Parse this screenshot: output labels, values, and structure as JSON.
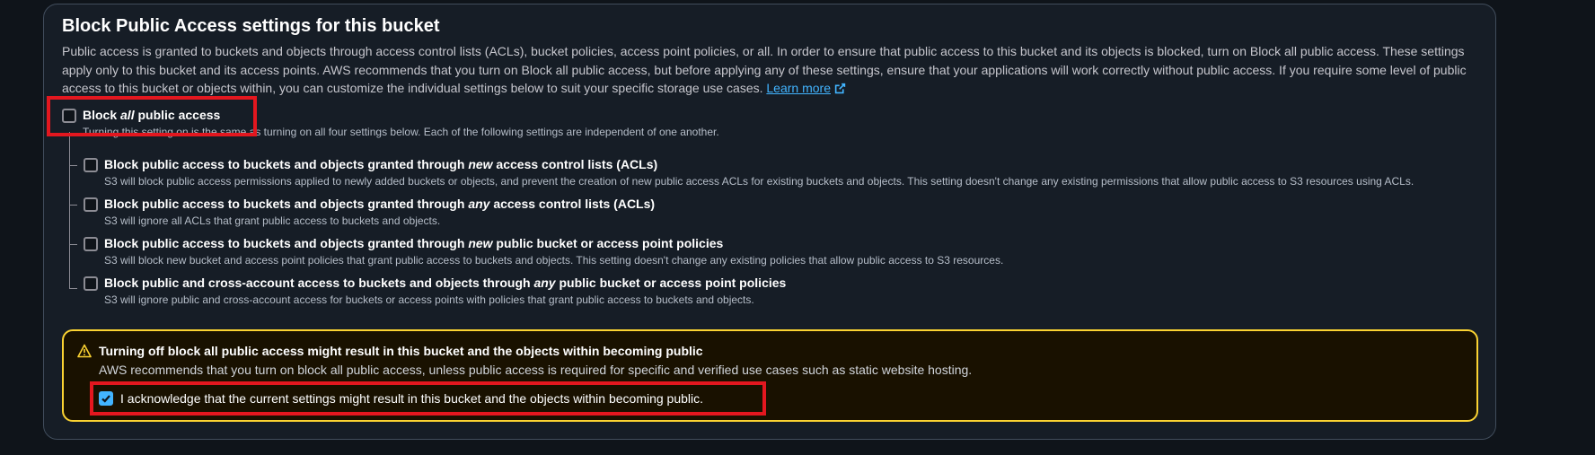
{
  "section": {
    "title": "Block Public Access settings for this bucket",
    "description": "Public access is granted to buckets and objects through access control lists (ACLs), bucket policies, access point policies, or all. In order to ensure that public access to this bucket and its objects is blocked, turn on Block all public access. These settings apply only to this bucket and its access points. AWS recommends that you turn on Block all public access, but before applying any of these settings, ensure that your applications will work correctly without public access. If you require some level of public access to this bucket or objects within, you can customize the individual settings below to suit your specific storage use cases.",
    "learn_more": "Learn more"
  },
  "block_all": {
    "label_pre": "Block ",
    "label_em": "all",
    "label_post": " public access",
    "description": "Turning this setting on is the same as turning on all four settings below. Each of the following settings are independent of one another.",
    "checked": false
  },
  "options": [
    {
      "label_pre": "Block public access to buckets and objects granted through ",
      "label_em": "new",
      "label_post": " access control lists (ACLs)",
      "description": "S3 will block public access permissions applied to newly added buckets or objects, and prevent the creation of new public access ACLs for existing buckets and objects. This setting doesn't change any existing permissions that allow public access to S3 resources using ACLs.",
      "checked": false
    },
    {
      "label_pre": "Block public access to buckets and objects granted through ",
      "label_em": "any",
      "label_post": " access control lists (ACLs)",
      "description": "S3 will ignore all ACLs that grant public access to buckets and objects.",
      "checked": false
    },
    {
      "label_pre": "Block public access to buckets and objects granted through ",
      "label_em": "new",
      "label_post": " public bucket or access point policies",
      "description": "S3 will block new bucket and access point policies that grant public access to buckets and objects. This setting doesn't change any existing policies that allow public access to S3 resources.",
      "checked": false
    },
    {
      "label_pre": "Block public and cross-account access to buckets and objects through ",
      "label_em": "any",
      "label_post": " public bucket or access point policies",
      "description": "S3 will ignore public and cross-account access for buckets or access points with policies that grant public access to buckets and objects.",
      "checked": false
    }
  ],
  "warning": {
    "icon": "warning-icon",
    "title": "Turning off block all public access might result in this bucket and the objects within becoming public",
    "text": "AWS recommends that you turn on block all public access, unless public access is required for specific and verified use cases such as static website hosting.",
    "acknowledge_label": "I acknowledge that the current settings might result in this bucket and the objects within becoming public.",
    "acknowledge_checked": true
  },
  "colors": {
    "background": "#0f141a",
    "panel": "#161d26",
    "link": "#42b4ff",
    "warning_border": "#fbd332",
    "highlight": "#e3171f"
  }
}
